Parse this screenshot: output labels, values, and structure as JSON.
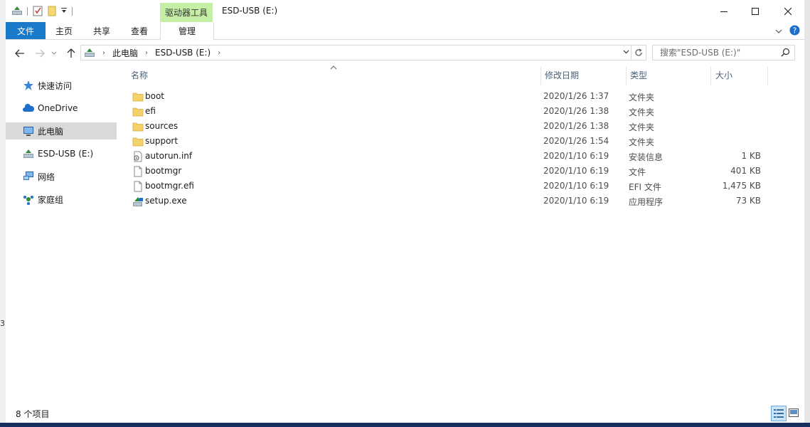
{
  "window": {
    "title": "ESD-USB (E:)",
    "context_tab_label": "驱动器工具"
  },
  "ribbon": {
    "tabs": [
      {
        "label": "文件"
      },
      {
        "label": "主页"
      },
      {
        "label": "共享"
      },
      {
        "label": "查看"
      },
      {
        "label": "管理"
      }
    ]
  },
  "address": {
    "crumbs": [
      "此电脑",
      "ESD-USB (E:)"
    ],
    "search_placeholder": "搜索\"ESD-USB (E:)\""
  },
  "sidebar": {
    "items": [
      {
        "label": "快速访问",
        "icon": "star-icon"
      },
      {
        "label": "OneDrive",
        "icon": "cloud-icon"
      },
      {
        "label": "此电脑",
        "icon": "computer-icon",
        "selected": true
      },
      {
        "label": "ESD-USB (E:)",
        "icon": "usb-drive-icon"
      },
      {
        "label": "网络",
        "icon": "network-icon"
      },
      {
        "label": "家庭组",
        "icon": "homegroup-icon"
      }
    ]
  },
  "columns": {
    "name": "名称",
    "date": "修改日期",
    "type": "类型",
    "size": "大小"
  },
  "files": [
    {
      "name": "boot",
      "date": "2020/1/26 1:37",
      "type": "文件夹",
      "size": "",
      "icon": "folder-icon"
    },
    {
      "name": "efi",
      "date": "2020/1/26 1:38",
      "type": "文件夹",
      "size": "",
      "icon": "folder-icon"
    },
    {
      "name": "sources",
      "date": "2020/1/26 1:38",
      "type": "文件夹",
      "size": "",
      "icon": "folder-icon"
    },
    {
      "name": "support",
      "date": "2020/1/26 1:54",
      "type": "文件夹",
      "size": "",
      "icon": "folder-icon"
    },
    {
      "name": "autorun.inf",
      "date": "2020/1/10 6:19",
      "type": "安装信息",
      "size": "1 KB",
      "icon": "settings-file-icon"
    },
    {
      "name": "bootmgr",
      "date": "2020/1/10 6:19",
      "type": "文件",
      "size": "401 KB",
      "icon": "file-icon"
    },
    {
      "name": "bootmgr.efi",
      "date": "2020/1/10 6:19",
      "type": "EFI 文件",
      "size": "1,475 KB",
      "icon": "file-icon"
    },
    {
      "name": "setup.exe",
      "date": "2020/1/10 6:19",
      "type": "应用程序",
      "size": "73 KB",
      "icon": "setup-exe-icon"
    }
  ],
  "status": {
    "count": "8 个项目"
  },
  "edge_text": "3",
  "colors": {
    "accent": "#1979ca",
    "context_tab": "#c6efa6",
    "selected_item": "#d9d9d9",
    "folder": "#f4d26a"
  }
}
